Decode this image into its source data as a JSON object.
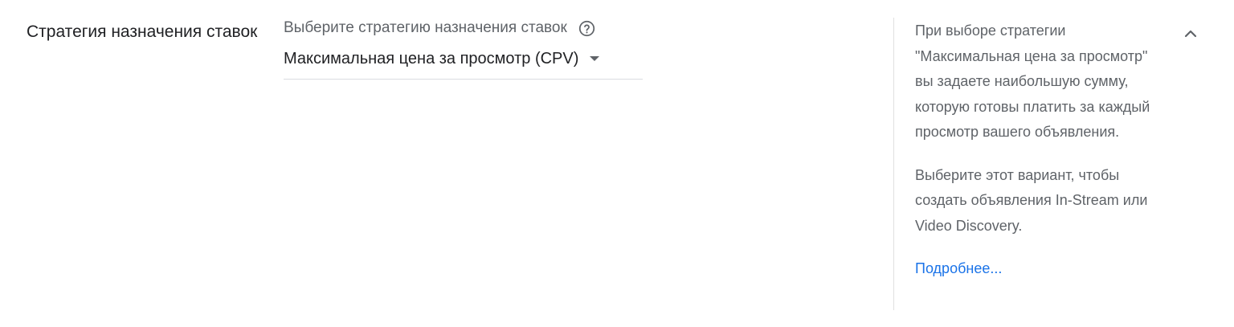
{
  "section": {
    "title": "Стратегия назначения ставок"
  },
  "field": {
    "label": "Выберите стратегию назначения ставок",
    "help_icon": "help-circle-icon",
    "selected_value": "Максимальная цена за просмотр (CPV)",
    "dropdown_icon": "arrow-drop-down-icon"
  },
  "help_panel": {
    "paragraph1": "При выборе стратегии \"Максимальная цена за просмотр\" вы задаете наибольшую сумму, которую готовы платить за каждый просмотр вашего объявления.",
    "paragraph2": "Выберите этот вариант, чтобы создать объявления In-Stream или Video Discovery.",
    "learn_more": "Подробнее...",
    "collapse_icon": "chevron-up-icon"
  },
  "colors": {
    "primary_text": "#202124",
    "secondary_text": "#5f6368",
    "link": "#1a73e8",
    "divider": "#e0e0e0"
  }
}
